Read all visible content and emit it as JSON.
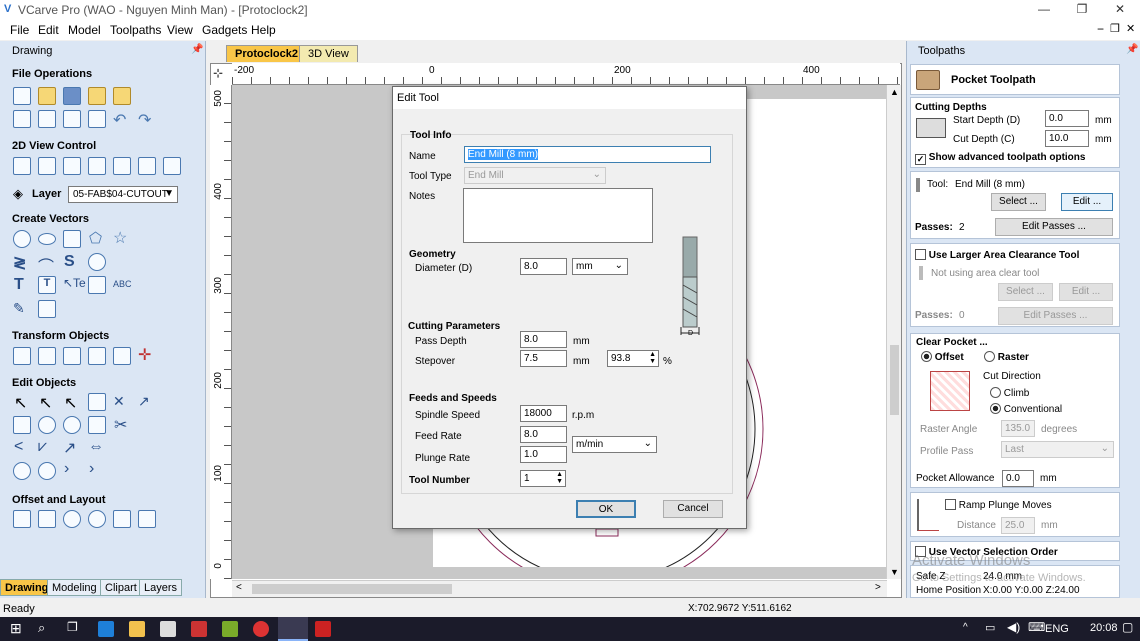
{
  "window": {
    "title": "VCarve Pro (WAO - Nguyen Minh Man) - [Protoclock2]"
  },
  "menu": [
    "File",
    "Edit",
    "Model",
    "Toolpaths",
    "View",
    "Gadgets",
    "Help"
  ],
  "left": {
    "header": "Drawing",
    "sections": {
      "file": "File Operations",
      "view": "2D View Control",
      "create": "Create Vectors",
      "transform": "Transform Objects",
      "edit": "Edit Objects",
      "offset": "Offset and Layout"
    },
    "layer_label": "Layer",
    "layer_value": "05-FAB$04-CUTOUT",
    "tabs": [
      "Drawing",
      "Modeling",
      "Clipart",
      "Layers"
    ]
  },
  "doc_tabs": [
    "Protoclock2",
    "3D View"
  ],
  "ruler": {
    "h": [
      "-200",
      "0",
      "200",
      "400"
    ],
    "v": [
      "500",
      "400",
      "300",
      "200",
      "100",
      "0"
    ]
  },
  "dialog": {
    "title": "Edit Tool",
    "tool_info": "Tool Info",
    "name_label": "Name",
    "name_value": "End Mill (8 mm)",
    "tooltype_label": "Tool Type",
    "tooltype_value": "End Mill",
    "notes_label": "Notes",
    "geometry": "Geometry",
    "diameter_label": "Diameter (D)",
    "diameter_value": "8.0",
    "diameter_unit": "mm",
    "cutting": "Cutting Parameters",
    "passdepth_label": "Pass Depth",
    "passdepth_value": "8.0",
    "passdepth_unit": "mm",
    "stepover_label": "Stepover",
    "stepover_value": "7.5",
    "stepover_unit": "mm",
    "stepover_pct": "93.8",
    "pct": "%",
    "feeds": "Feeds and Speeds",
    "spindle_label": "Spindle Speed",
    "spindle_value": "18000",
    "spindle_unit": "r.p.m",
    "feed_label": "Feed Rate",
    "feed_value": "8.0",
    "rate_unit": "m/min",
    "plunge_label": "Plunge Rate",
    "plunge_value": "1.0",
    "toolnum_label": "Tool Number",
    "toolnum_value": "1",
    "ok": "OK",
    "cancel": "Cancel"
  },
  "right": {
    "header": "Toolpaths",
    "title": "Pocket Toolpath",
    "cutting_depths": "Cutting Depths",
    "start_label": "Start Depth (D)",
    "start_value": "0.0",
    "cut_label": "Cut Depth (C)",
    "cut_value": "10.0",
    "mm": "mm",
    "show_adv": "Show advanced toolpath options",
    "tool_label": "Tool:",
    "tool_value": "End Mill (8 mm)",
    "select": "Select ...",
    "edit": "Edit ...",
    "passes_label": "Passes:",
    "passes_value": "2",
    "edit_passes": "Edit Passes ...",
    "larger": "Use Larger Area Clearance Tool",
    "not_using": "Not using area clear tool",
    "passes2_value": "0",
    "clear_pocket": "Clear Pocket ...",
    "offset": "Offset",
    "raster": "Raster",
    "cut_dir": "Cut Direction",
    "climb": "Climb",
    "conventional": "Conventional",
    "raster_angle": "Raster Angle",
    "raster_angle_value": "135.0",
    "degrees": "degrees",
    "profile_pass": "Profile Pass",
    "profile_pass_value": "Last",
    "pocket_allow": "Pocket Allowance",
    "pocket_allow_value": "0.0",
    "ramp": "Ramp Plunge Moves",
    "distance": "Distance",
    "distance_value": "25.0",
    "vector_order": "Use Vector Selection Order",
    "safez": "Safe Z",
    "safez_value": "24.0 mm",
    "home": "Home Position",
    "home_value": "X:0.00 Y:0.00 Z:24.00",
    "watermark1": "Activate Windows",
    "watermark2": "Go to Settings to activate Windows."
  },
  "status": {
    "left": "Ready",
    "coords": "X:702.9672 Y:511.6162"
  },
  "taskbar": {
    "lang": "ENG",
    "time": "20:08"
  }
}
